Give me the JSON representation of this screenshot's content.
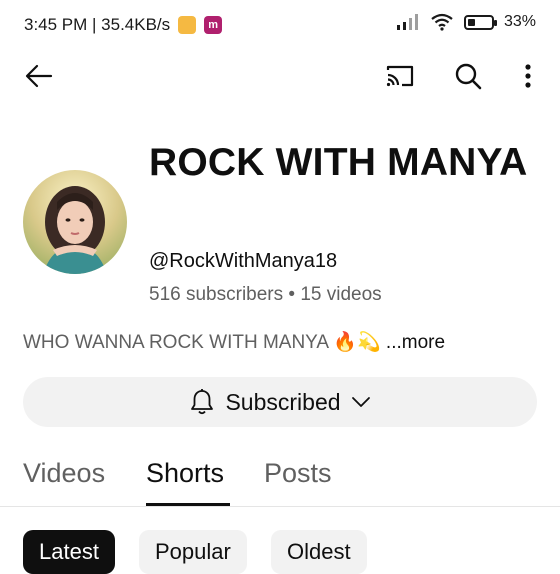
{
  "status_bar": {
    "time_speed": "3:45 PM | 35.4KB/s",
    "app_badge_1": "",
    "app_badge_2": "m",
    "battery": "33",
    "battery_level": 0.33
  },
  "channel": {
    "name": "ROCK WITH MANYA",
    "handle": "@RockWithManya18",
    "meta": "516 subscribers • 15 videos",
    "description": "WHO WANNA ROCK WITH MANYA 🔥💫",
    "more_label": " ...more"
  },
  "subscribe_button": {
    "label": "Subscribed"
  },
  "tabs": [
    {
      "label": "Videos"
    },
    {
      "label": "Shorts"
    },
    {
      "label": "Posts"
    }
  ],
  "filters": [
    {
      "label": "Latest"
    },
    {
      "label": "Popular"
    },
    {
      "label": "Oldest"
    }
  ],
  "colors": {
    "text": "#0f0f0f",
    "secondary_text": "#606060",
    "chip_bg": "#f2f2f2",
    "selected_chip_bg": "#0f0f0f"
  }
}
